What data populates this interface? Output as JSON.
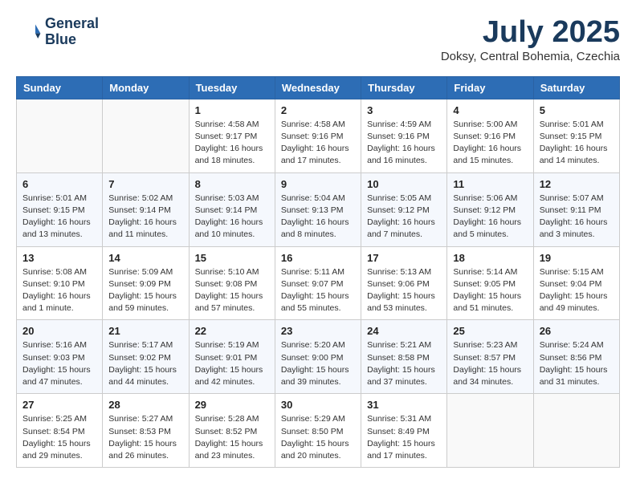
{
  "header": {
    "logo_line1": "General",
    "logo_line2": "Blue",
    "month_year": "July 2025",
    "location": "Doksy, Central Bohemia, Czechia"
  },
  "weekdays": [
    "Sunday",
    "Monday",
    "Tuesday",
    "Wednesday",
    "Thursday",
    "Friday",
    "Saturday"
  ],
  "weeks": [
    [
      {
        "day": "",
        "info": ""
      },
      {
        "day": "",
        "info": ""
      },
      {
        "day": "1",
        "info": "Sunrise: 4:58 AM\nSunset: 9:17 PM\nDaylight: 16 hours\nand 18 minutes."
      },
      {
        "day": "2",
        "info": "Sunrise: 4:58 AM\nSunset: 9:16 PM\nDaylight: 16 hours\nand 17 minutes."
      },
      {
        "day": "3",
        "info": "Sunrise: 4:59 AM\nSunset: 9:16 PM\nDaylight: 16 hours\nand 16 minutes."
      },
      {
        "day": "4",
        "info": "Sunrise: 5:00 AM\nSunset: 9:16 PM\nDaylight: 16 hours\nand 15 minutes."
      },
      {
        "day": "5",
        "info": "Sunrise: 5:01 AM\nSunset: 9:15 PM\nDaylight: 16 hours\nand 14 minutes."
      }
    ],
    [
      {
        "day": "6",
        "info": "Sunrise: 5:01 AM\nSunset: 9:15 PM\nDaylight: 16 hours\nand 13 minutes."
      },
      {
        "day": "7",
        "info": "Sunrise: 5:02 AM\nSunset: 9:14 PM\nDaylight: 16 hours\nand 11 minutes."
      },
      {
        "day": "8",
        "info": "Sunrise: 5:03 AM\nSunset: 9:14 PM\nDaylight: 16 hours\nand 10 minutes."
      },
      {
        "day": "9",
        "info": "Sunrise: 5:04 AM\nSunset: 9:13 PM\nDaylight: 16 hours\nand 8 minutes."
      },
      {
        "day": "10",
        "info": "Sunrise: 5:05 AM\nSunset: 9:12 PM\nDaylight: 16 hours\nand 7 minutes."
      },
      {
        "day": "11",
        "info": "Sunrise: 5:06 AM\nSunset: 9:12 PM\nDaylight: 16 hours\nand 5 minutes."
      },
      {
        "day": "12",
        "info": "Sunrise: 5:07 AM\nSunset: 9:11 PM\nDaylight: 16 hours\nand 3 minutes."
      }
    ],
    [
      {
        "day": "13",
        "info": "Sunrise: 5:08 AM\nSunset: 9:10 PM\nDaylight: 16 hours\nand 1 minute."
      },
      {
        "day": "14",
        "info": "Sunrise: 5:09 AM\nSunset: 9:09 PM\nDaylight: 15 hours\nand 59 minutes."
      },
      {
        "day": "15",
        "info": "Sunrise: 5:10 AM\nSunset: 9:08 PM\nDaylight: 15 hours\nand 57 minutes."
      },
      {
        "day": "16",
        "info": "Sunrise: 5:11 AM\nSunset: 9:07 PM\nDaylight: 15 hours\nand 55 minutes."
      },
      {
        "day": "17",
        "info": "Sunrise: 5:13 AM\nSunset: 9:06 PM\nDaylight: 15 hours\nand 53 minutes."
      },
      {
        "day": "18",
        "info": "Sunrise: 5:14 AM\nSunset: 9:05 PM\nDaylight: 15 hours\nand 51 minutes."
      },
      {
        "day": "19",
        "info": "Sunrise: 5:15 AM\nSunset: 9:04 PM\nDaylight: 15 hours\nand 49 minutes."
      }
    ],
    [
      {
        "day": "20",
        "info": "Sunrise: 5:16 AM\nSunset: 9:03 PM\nDaylight: 15 hours\nand 47 minutes."
      },
      {
        "day": "21",
        "info": "Sunrise: 5:17 AM\nSunset: 9:02 PM\nDaylight: 15 hours\nand 44 minutes."
      },
      {
        "day": "22",
        "info": "Sunrise: 5:19 AM\nSunset: 9:01 PM\nDaylight: 15 hours\nand 42 minutes."
      },
      {
        "day": "23",
        "info": "Sunrise: 5:20 AM\nSunset: 9:00 PM\nDaylight: 15 hours\nand 39 minutes."
      },
      {
        "day": "24",
        "info": "Sunrise: 5:21 AM\nSunset: 8:58 PM\nDaylight: 15 hours\nand 37 minutes."
      },
      {
        "day": "25",
        "info": "Sunrise: 5:23 AM\nSunset: 8:57 PM\nDaylight: 15 hours\nand 34 minutes."
      },
      {
        "day": "26",
        "info": "Sunrise: 5:24 AM\nSunset: 8:56 PM\nDaylight: 15 hours\nand 31 minutes."
      }
    ],
    [
      {
        "day": "27",
        "info": "Sunrise: 5:25 AM\nSunset: 8:54 PM\nDaylight: 15 hours\nand 29 minutes."
      },
      {
        "day": "28",
        "info": "Sunrise: 5:27 AM\nSunset: 8:53 PM\nDaylight: 15 hours\nand 26 minutes."
      },
      {
        "day": "29",
        "info": "Sunrise: 5:28 AM\nSunset: 8:52 PM\nDaylight: 15 hours\nand 23 minutes."
      },
      {
        "day": "30",
        "info": "Sunrise: 5:29 AM\nSunset: 8:50 PM\nDaylight: 15 hours\nand 20 minutes."
      },
      {
        "day": "31",
        "info": "Sunrise: 5:31 AM\nSunset: 8:49 PM\nDaylight: 15 hours\nand 17 minutes."
      },
      {
        "day": "",
        "info": ""
      },
      {
        "day": "",
        "info": ""
      }
    ]
  ]
}
